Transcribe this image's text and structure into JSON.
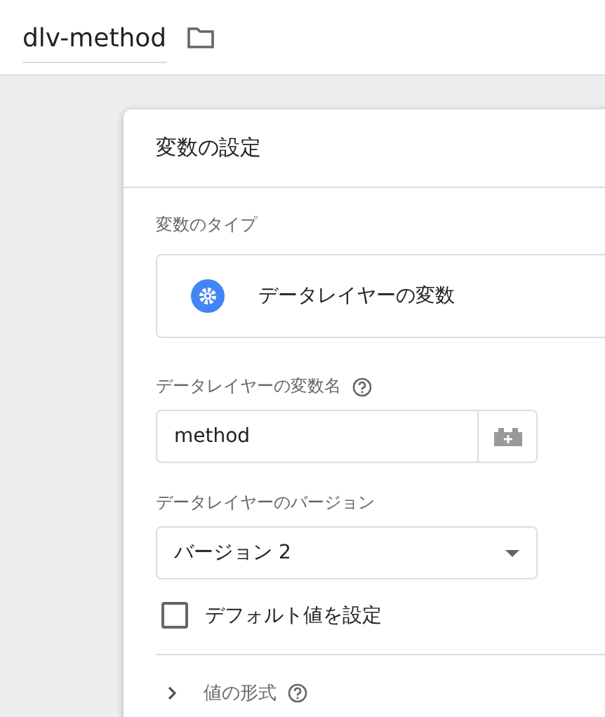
{
  "header": {
    "title": "dlv-method"
  },
  "card": {
    "title": "変数の設定",
    "type_label": "変数のタイプ",
    "type_value": "データレイヤーの変数",
    "name_field": {
      "label": "データレイヤーの変数名",
      "value": "method"
    },
    "version_field": {
      "label": "データレイヤーのバージョン",
      "value": "バージョン 2"
    },
    "default_checkbox": {
      "label": "デフォルト値を設定",
      "checked": false
    },
    "format_section": {
      "label": "値の形式",
      "expanded": false
    }
  }
}
